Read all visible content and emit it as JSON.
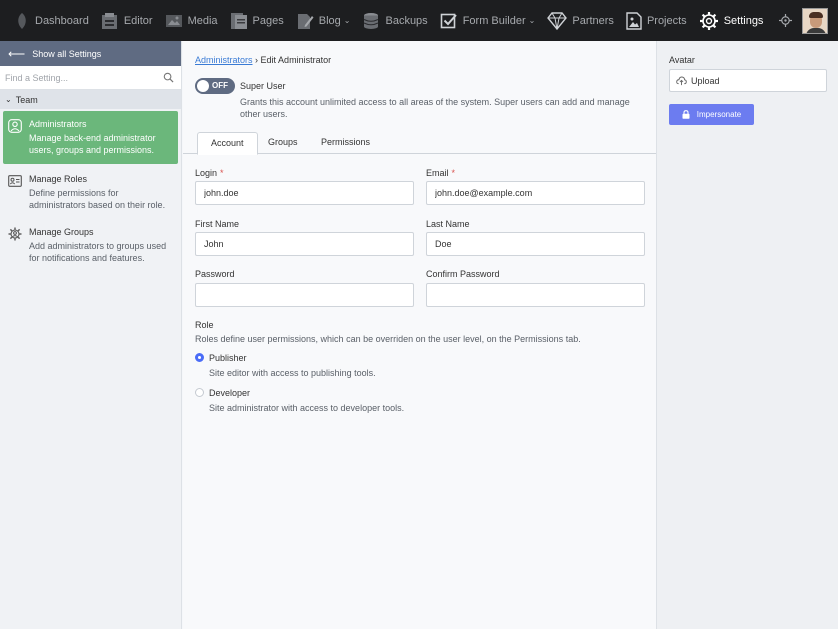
{
  "nav": {
    "items": [
      {
        "label": "Dashboard",
        "icon": "leaf-icon"
      },
      {
        "label": "Editor",
        "icon": "editor-icon"
      },
      {
        "label": "Media",
        "icon": "image-icon"
      },
      {
        "label": "Pages",
        "icon": "pages-icon"
      },
      {
        "label": "Blog",
        "icon": "pen-icon",
        "dropdown": true
      },
      {
        "label": "Backups",
        "icon": "database-icon"
      },
      {
        "label": "Form Builder",
        "icon": "checkbox-icon",
        "dropdown": true
      },
      {
        "label": "Partners",
        "icon": "diamond-icon"
      },
      {
        "label": "Projects",
        "icon": "file-image-icon"
      },
      {
        "label": "Settings",
        "icon": "gear-icon",
        "active": true
      }
    ]
  },
  "sidebar": {
    "back_label": "Show all Settings",
    "search_placeholder": "Find a Setting...",
    "group_label": "Team",
    "items": [
      {
        "title": "Administrators",
        "desc": "Manage back-end administrator users, groups and permissions.",
        "active": true
      },
      {
        "title": "Manage Roles",
        "desc": "Define permissions for administrators based on their role."
      },
      {
        "title": "Manage Groups",
        "desc": "Add administrators to groups used for notifications and features."
      }
    ]
  },
  "main": {
    "breadcrumb_link": "Administrators",
    "breadcrumb_sep": "›",
    "breadcrumb_current": "Edit Administrator",
    "super_user": {
      "toggle_label": "OFF",
      "title": "Super User",
      "desc": "Grants this account unlimited access to all areas of the system. Super users can add and manage other users."
    },
    "tabs": [
      {
        "label": "Account",
        "active": true
      },
      {
        "label": "Groups"
      },
      {
        "label": "Permissions"
      }
    ],
    "fields": {
      "login": {
        "label": "Login",
        "value": "john.doe",
        "required": "*"
      },
      "email": {
        "label": "Email",
        "value": "john.doe@example.com",
        "required": "*"
      },
      "first_name": {
        "label": "First Name",
        "value": "John"
      },
      "last_name": {
        "label": "Last Name",
        "value": "Doe"
      },
      "password": {
        "label": "Password",
        "value": ""
      },
      "confirm_password": {
        "label": "Confirm Password",
        "value": ""
      }
    },
    "role": {
      "title": "Role",
      "desc": "Roles define user permissions, which can be overriden on the user level, on the Permissions tab.",
      "options": [
        {
          "title": "Publisher",
          "desc": "Site editor with access to publishing tools.",
          "checked": true
        },
        {
          "title": "Developer",
          "desc": "Site administrator with access to developer tools.",
          "checked": false
        }
      ]
    }
  },
  "rpanel": {
    "avatar_label": "Avatar",
    "upload_label": "Upload",
    "impersonate_label": "Impersonate"
  }
}
